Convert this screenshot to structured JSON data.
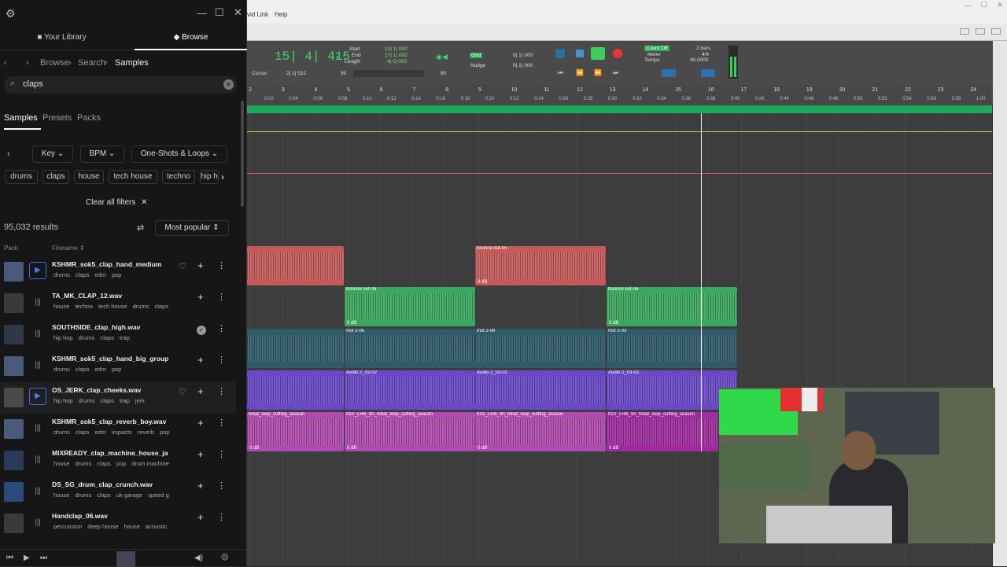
{
  "library": {
    "tab_library": "Your Library",
    "tab_browse": "Browse",
    "breadcrumb": [
      "Browse",
      "Search",
      "Samples"
    ],
    "search_value": "claps",
    "type_tabs": [
      "Samples",
      "Presets",
      "Packs"
    ],
    "filters": [
      "Key",
      "BPM",
      "One-Shots & Loops"
    ],
    "tags": [
      "drums",
      "claps",
      "house",
      "tech house",
      "techno",
      "hip h"
    ],
    "clear_filters": "Clear all filters",
    "results_count": "95,032 results",
    "sort": "Most popular",
    "col_pack": "Pack",
    "col_filename": "Filename"
  },
  "rows": [
    {
      "name": "KSHMR_sok5_clap_hand_medium",
      "tags": [
        "drums",
        "claps",
        "edm",
        "pop"
      ],
      "thumb": "#4a5a7a",
      "state": "playing"
    },
    {
      "name": "TA_MK_CLAP_12.wav",
      "tags": [
        "house",
        "techno",
        "tech house",
        "drums",
        "claps"
      ],
      "thumb": "#3a3a3a",
      "state": "normal"
    },
    {
      "name": "SOUTHSIDE_clap_high.wav",
      "tags": [
        "hip hop",
        "drums",
        "claps",
        "trap"
      ],
      "thumb": "#303848",
      "state": "downloaded"
    },
    {
      "name": "KSHMR_sok5_clap_hand_big_group_gli",
      "tags": [
        "drums",
        "claps",
        "edm",
        "pop"
      ],
      "thumb": "#4a5a7a",
      "state": "normal"
    },
    {
      "name": "OS_JERK_clap_cheeks.wav",
      "tags": [
        "hip hop",
        "drums",
        "claps",
        "trap",
        "jerk"
      ],
      "thumb": "#4a4a4a",
      "state": "selected"
    },
    {
      "name": "KSHMR_sok5_clap_reverb_boy.wav",
      "tags": [
        "drums",
        "claps",
        "edm",
        "impacts",
        "reverb",
        "pop"
      ],
      "thumb": "#4a5a7a",
      "state": "normal"
    },
    {
      "name": "MIXREADY_clap_machine_house_jacker",
      "tags": [
        "house",
        "drums",
        "claps",
        "pop",
        "drum machine"
      ],
      "thumb": "#2a3a5a",
      "state": "normal"
    },
    {
      "name": "DS_SG_drum_clap_crunch.wav",
      "tags": [
        "house",
        "drums",
        "claps",
        "uk garage",
        "speed g"
      ],
      "thumb": "#2a4a7a",
      "state": "normal"
    },
    {
      "name": "Handclap_06.wav",
      "tags": [
        "percussion",
        "deep house",
        "house",
        "acoustic"
      ],
      "thumb": "#3a3a3a",
      "state": "normal"
    }
  ],
  "daw": {
    "menu": [
      "vid Link",
      "Help"
    ],
    "counter": "15| 4| 415",
    "start_label": "Start",
    "end_label": "End",
    "length_label": "Length",
    "start_val": "13| 1| 000",
    "end_val": "17| 1| 000",
    "length_val": "4| 0| 000",
    "cursor_label": "Cursor",
    "cursor_val": "2| 1| 522",
    "grid_label": "Grid",
    "nudge_label": "Nudge",
    "grid_val": "0| 1| 000",
    "nudge_val": "0| 1| 000",
    "count_off": "Count Off",
    "meter_label": "Meter",
    "tempo_label": "Tempo",
    "meter_val": "4/4",
    "tempo_val": "90.0000",
    "bars_val": "2 bars",
    "val_90": "90",
    "val_80": "80",
    "ruler_bars": [
      "2",
      "3",
      "4",
      "5",
      "6",
      "7",
      "8",
      "9",
      "10",
      "11",
      "12",
      "13",
      "14",
      "15",
      "16",
      "17",
      "18",
      "19",
      "20",
      "21",
      "22",
      "23",
      "24"
    ],
    "ruler_tc": [
      "0:02",
      "0:04",
      "0:06",
      "0:08",
      "0:10",
      "0:12",
      "0:14",
      "0:16",
      "0:18",
      "0:20",
      "0:22",
      "0:24",
      "0:26",
      "0:28",
      "0:30",
      "0:32",
      "0:34",
      "0:36",
      "0:38",
      "0:40",
      "0:42",
      "0:44",
      "0:46",
      "0:48",
      "0:50",
      "0:52",
      "0:54",
      "0:56",
      "0:58",
      "1:00",
      "1:02"
    ],
    "clip_bounce5": "bounce out-05",
    "clip_bounce6": "bounce out-06",
    "clip_inst205": "Inst 2-05",
    "clip_inst206": "Inst 2-06",
    "clip_inst203": "Inst 2-03",
    "clip_audio": "Audio 2_03-02",
    "clip_loop": "91V_LRB_90_hihat_loop_cuffing_season",
    "clip_loop_cut": "hihat_loop_cuffing_season",
    "gain": "0 dB"
  },
  "colors": {
    "accent": "#3a6df0",
    "counter": "#3fd66b",
    "red_clip": "#c65a5a",
    "green_clip": "#3aa85e",
    "teal_clip": "#2f5a6a",
    "purple_clip": "#6a48c8",
    "pink_clip": "#b04ab0"
  }
}
